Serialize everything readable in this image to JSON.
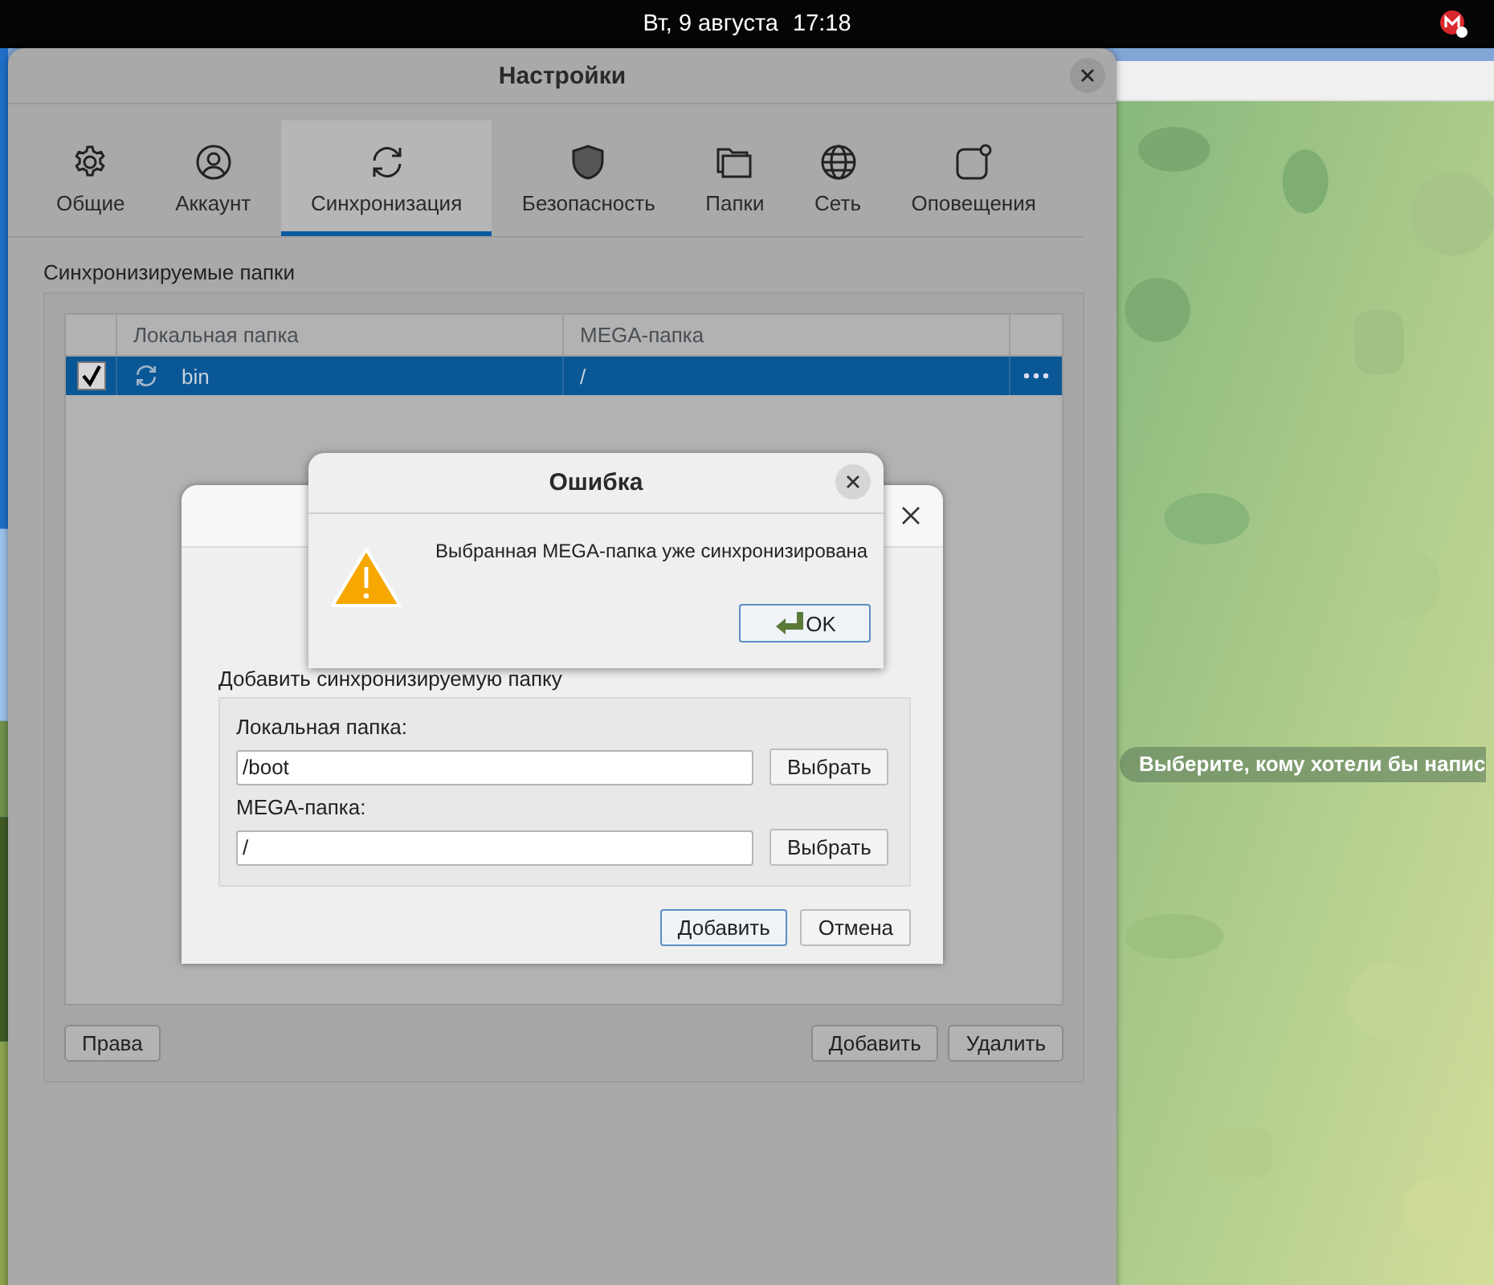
{
  "top_bar": {
    "date": "Вт, 9 августа",
    "time": "17:18"
  },
  "settings_window": {
    "title": "Настройки",
    "tabs": [
      {
        "label": "Общие",
        "selected": false
      },
      {
        "label": "Аккаунт",
        "selected": false
      },
      {
        "label": "Синхронизация",
        "selected": true
      },
      {
        "label": "Безопасность",
        "selected": false
      },
      {
        "label": "Папки",
        "selected": false
      },
      {
        "label": "Сеть",
        "selected": false
      },
      {
        "label": "Оповещения",
        "selected": false
      }
    ],
    "section_title": "Синхронизируемые папки",
    "table": {
      "columns": [
        "Локальная папка",
        "MEGA-папка"
      ],
      "rows": [
        {
          "checked": true,
          "selected": true,
          "local": "bin",
          "mega": "/"
        }
      ]
    },
    "left_buttons": [
      "Права"
    ],
    "right_buttons": [
      "Добавить",
      "Удалить"
    ]
  },
  "add_dialog": {
    "group_title": "Добавить синхронизируемую папку",
    "fields": [
      {
        "label": "Локальная папка:",
        "value": "/boot",
        "button": "Выбрать"
      },
      {
        "label": "MEGA-папка:",
        "value": "/",
        "button": "Выбрать"
      }
    ],
    "buttons": [
      {
        "label": "Добавить",
        "default": true
      },
      {
        "label": "Отмена",
        "default": false
      }
    ]
  },
  "error_dialog": {
    "title": "Ошибка",
    "message": "Выбранная MEGA-папка уже синхронизирована",
    "button": "OK"
  },
  "chat": {
    "hint": "Выберите, кому хотели бы напис"
  }
}
